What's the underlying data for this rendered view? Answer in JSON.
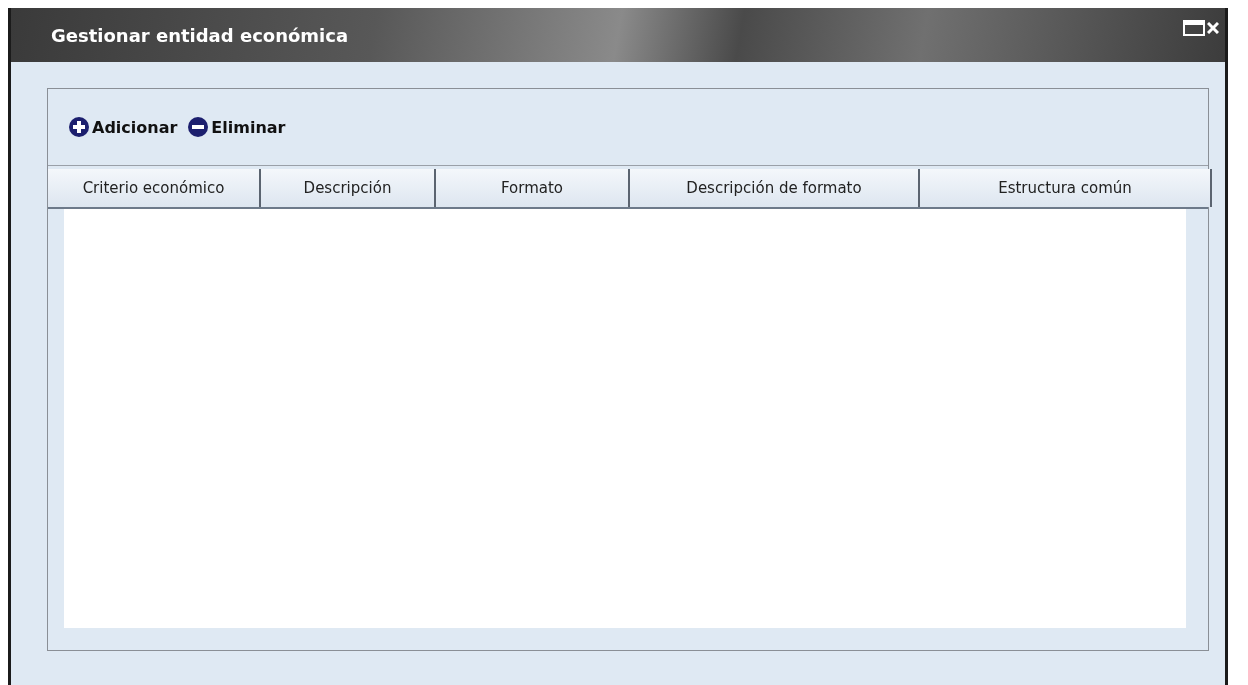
{
  "window": {
    "title": "Gestionar entidad económica"
  },
  "toolbar": [
    {
      "kind": "add",
      "label": "Adicionar"
    },
    {
      "kind": "remove",
      "label": "Eliminar"
    }
  ],
  "table": {
    "columns": [
      "Criterio económico",
      "Descripción",
      "Formato",
      "Descripción de formato",
      "Estructura común"
    ]
  }
}
